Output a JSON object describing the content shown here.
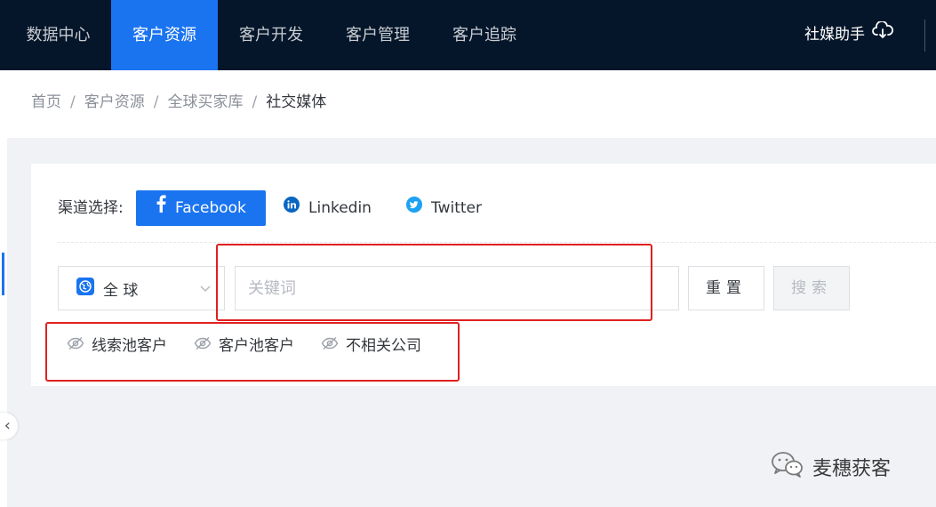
{
  "nav": {
    "items": [
      {
        "label": "数据中心"
      },
      {
        "label": "客户资源"
      },
      {
        "label": "客户开发"
      },
      {
        "label": "客户管理"
      },
      {
        "label": "客户追踪"
      }
    ],
    "active_index": 1,
    "helper_label": "社媒助手",
    "helper_icon": "cloud-download-icon"
  },
  "breadcrumb": {
    "items": [
      "首页",
      "客户资源",
      "全球买家库",
      "社交媒体"
    ],
    "separator": "/"
  },
  "channel": {
    "label": "渠道选择:",
    "options": [
      {
        "label": "Facebook",
        "icon": "facebook-icon"
      },
      {
        "label": "Linkedin",
        "icon": "linkedin-icon"
      },
      {
        "label": "Twitter",
        "icon": "twitter-icon"
      }
    ],
    "selected": "Facebook"
  },
  "search": {
    "region_value": "全 球",
    "keyword_placeholder": "关键词",
    "keyword_value": "",
    "reset_label": "重置",
    "search_label": "搜索"
  },
  "filters": [
    {
      "label": "线索池客户",
      "icon": "eye-off-icon"
    },
    {
      "label": "客户池客户",
      "icon": "eye-off-icon"
    },
    {
      "label": "不相关公司",
      "icon": "eye-off-icon"
    }
  ],
  "watermark": {
    "text": "麦穗获客",
    "icon": "wechat-icon"
  },
  "colors": {
    "topbar": "#05162a",
    "accent": "#1a74f0",
    "highlight_box": "#e02020",
    "twitter": "#1da1f2",
    "linkedin": "#0a66c2"
  }
}
